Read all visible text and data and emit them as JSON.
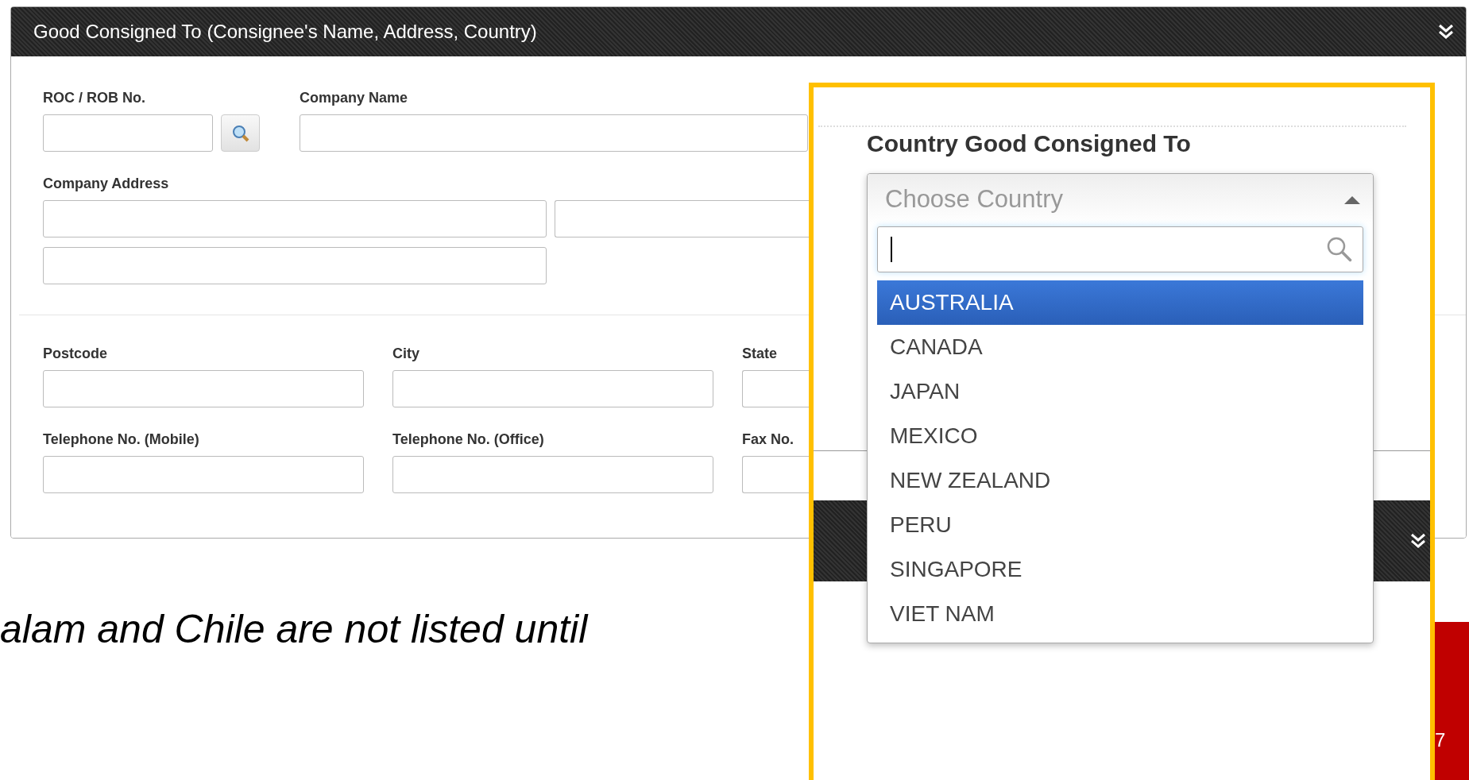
{
  "panel": {
    "title": "Good Consigned To (Consignee's Name, Address, Country)",
    "fields": [
      {
        "label": "ROC / ROB No."
      },
      {
        "label": "Company Name"
      },
      {
        "label": "Company Address"
      },
      {
        "label": "Postcode"
      },
      {
        "label": "City"
      },
      {
        "label": "State"
      },
      {
        "label": "Telephone No. (Mobile)"
      },
      {
        "label": "Telephone No. (Office)"
      },
      {
        "label": "Fax No."
      }
    ]
  },
  "callout": {
    "title": "Country Good Consigned To",
    "select": {
      "placeholder": "Choose Country",
      "expanded": true
    },
    "options": [
      {
        "label": "AUSTRALIA",
        "selected": true
      },
      {
        "label": "CANADA",
        "selected": false
      },
      {
        "label": "JAPAN",
        "selected": false
      },
      {
        "label": "MEXICO",
        "selected": false
      },
      {
        "label": "NEW ZEALAND",
        "selected": false
      },
      {
        "label": "PERU",
        "selected": false
      },
      {
        "label": "SINGAPORE",
        "selected": false
      },
      {
        "label": "VIET NAM",
        "selected": false
      }
    ]
  },
  "note": "alam and Chile are not listed until",
  "page_number": "7"
}
